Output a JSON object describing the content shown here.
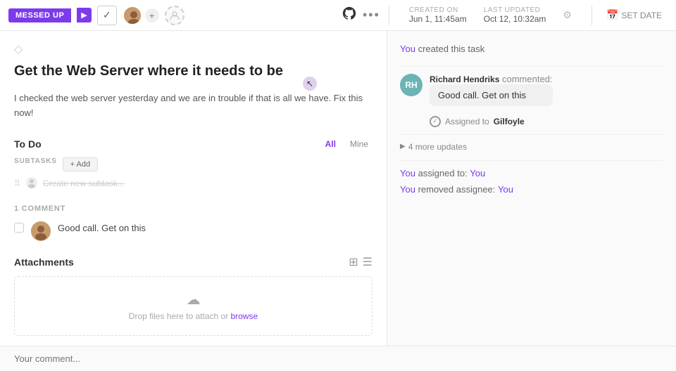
{
  "toolbar": {
    "status_label": "MESSED UP",
    "check_icon": "✓",
    "arrow_icon": "▶",
    "more_icon": "•••",
    "github_icon": "⊙"
  },
  "dates": {
    "created_label": "CREATED ON",
    "created_value": "Jun 1, 11:45am",
    "updated_label": "LAST UPDATED",
    "updated_value": "Oct 12, 10:32am",
    "set_date_label": "SET DATE"
  },
  "task": {
    "title": "Get the Web Server where it needs to be",
    "description": "I checked the web server yesterday and we are in trouble if that is all we have. Fix this now!",
    "tag_icon": "◇"
  },
  "todo": {
    "section_title": "To Do",
    "filter_all": "All",
    "filter_mine": "Mine",
    "subtasks_label": "SUBTASKS",
    "add_button": "+ Add",
    "create_placeholder": "Create new subtask..."
  },
  "comments": {
    "count_label": "1 COMMENT",
    "items": [
      {
        "text": "Good call. Get on this"
      }
    ]
  },
  "attachments": {
    "title": "Attachments",
    "drop_text": "Drop files here to attach or ",
    "browse_label": "browse"
  },
  "comment_bar": {
    "placeholder": "Your comment..."
  },
  "activity": {
    "created_text": "You created this task",
    "commenter_name": "Richard Hendriks",
    "commented_label": " commented:",
    "comment_text": "Good call. Get on this",
    "assigned_label": "Assigned to ",
    "assigned_to": "Gilfoyle",
    "more_updates_label": "4 more updates",
    "update1_prefix": "You assigned to: ",
    "update1_value": "You",
    "update2_prefix": "You removed assignee: ",
    "update2_value": "You"
  }
}
